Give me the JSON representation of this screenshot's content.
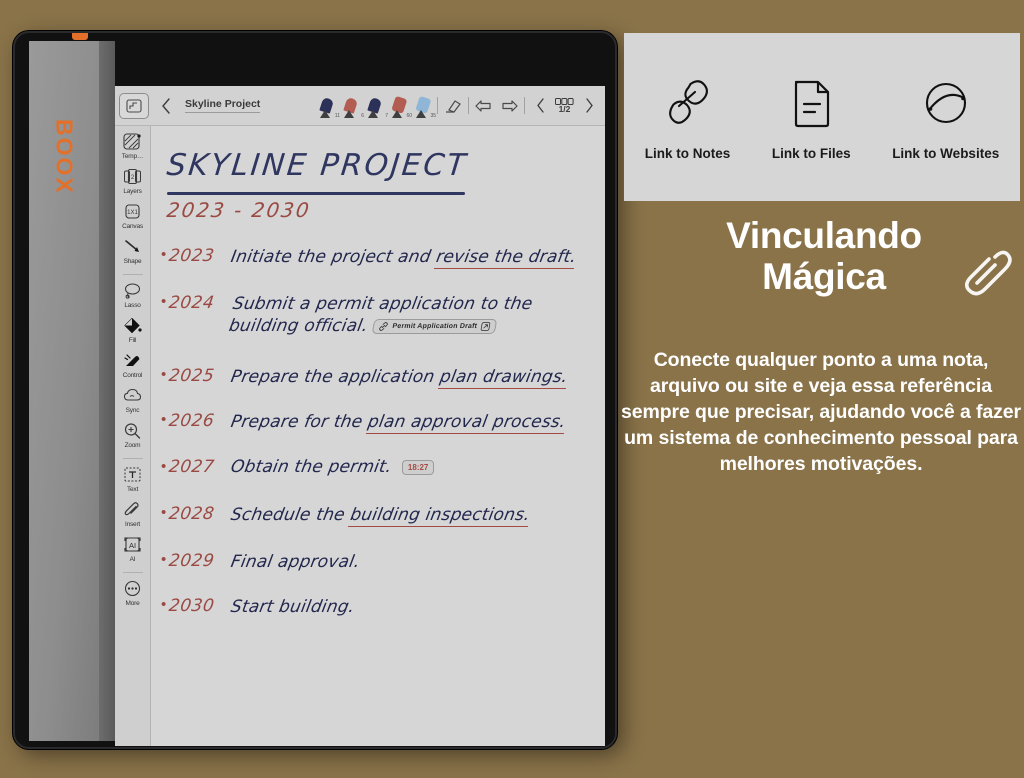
{
  "device": {
    "brand": "BOOX"
  },
  "app": {
    "topbar": {
      "template_icon": "template-icon",
      "back_icon": "chevron-left-icon",
      "note_title": "Skyline Project",
      "pens": [
        {
          "name": "pen-navy-fine",
          "size": "11",
          "color": "#2b3158",
          "type": "pen"
        },
        {
          "name": "pen-red-fine",
          "size": "6",
          "color": "#b35c52",
          "type": "pen"
        },
        {
          "name": "pen-navy-thin",
          "size": "7",
          "color": "#2b3158",
          "type": "pen"
        },
        {
          "name": "marker-red",
          "size": "60",
          "color": "#b35c52",
          "type": "marker"
        },
        {
          "name": "marker-blue",
          "size": "35",
          "color": "#8fb6d6",
          "type": "marker"
        }
      ],
      "eraser_icon": "eraser-icon",
      "undo_icon": "undo-arrow-icon",
      "redo_icon": "redo-arrow-icon",
      "prev_page_icon": "chevron-left-icon",
      "next_page_icon": "chevron-right-icon",
      "page_indicator": "1/2"
    },
    "rail": [
      {
        "label": "Temp…",
        "icon": "template-hatch-icon"
      },
      {
        "label": "Layers",
        "icon": "layers-icon"
      },
      {
        "label": "Canvas",
        "icon": "canvas-1x1-icon"
      },
      {
        "label": "Shape",
        "icon": "shape-line-icon"
      },
      {
        "label": "Lasso",
        "icon": "lasso-icon"
      },
      {
        "label": "Fill",
        "icon": "fill-bucket-icon"
      },
      {
        "label": "Control",
        "icon": "hand-control-icon"
      },
      {
        "label": "Sync",
        "icon": "cloud-sync-icon"
      },
      {
        "label": "Zoom",
        "icon": "zoom-magnifier-icon"
      },
      {
        "label": "Text",
        "icon": "text-box-icon"
      },
      {
        "label": "Insert",
        "icon": "paperclip-insert-icon"
      },
      {
        "label": "AI",
        "icon": "ai-icon"
      },
      {
        "label": "More",
        "icon": "more-dots-icon"
      }
    ],
    "note": {
      "title": "SKYLINE PROJECT",
      "subtitle": "2023 - 2030",
      "lines": [
        {
          "year": "2023",
          "before": "Initiate the project and ",
          "underlined": "revise the draft.",
          "after": ""
        },
        {
          "year": "2024",
          "before": "Submit a permit application to the building official.",
          "underlined": "",
          "after": "",
          "chip": {
            "type": "link",
            "label": "Permit Application Draft",
            "link_icon": "link-chain-icon",
            "open_icon": "external-link-icon"
          }
        },
        {
          "year": "2025",
          "before": "Prepare the application ",
          "underlined": "plan drawings.",
          "after": ""
        },
        {
          "year": "2026",
          "before": "Prepare for the ",
          "underlined": "plan approval process.",
          "after": ""
        },
        {
          "year": "2027",
          "before": "Obtain the permit.",
          "underlined": "",
          "after": "",
          "chip": {
            "type": "time",
            "label": "18:27"
          }
        },
        {
          "year": "2028",
          "before": "Schedule the ",
          "underlined": "building inspections.",
          "after": ""
        },
        {
          "year": "2029",
          "before": "Final approval.",
          "underlined": "",
          "after": ""
        },
        {
          "year": "2030",
          "before": "Start building.",
          "underlined": "",
          "after": ""
        }
      ]
    }
  },
  "link_panel": {
    "options": [
      {
        "label": "Link to Notes",
        "icon": "link-chain-icon"
      },
      {
        "label": "Link to Files",
        "icon": "file-document-icon"
      },
      {
        "label": "Link to Websites",
        "icon": "globe-icon"
      }
    ]
  },
  "promo": {
    "headline_line1": "Vinculando",
    "headline_line2": "Mágica",
    "headline_icon": "paperclip-icon",
    "body": "Conecte qualquer ponto a uma nota, arquivo ou site e veja essa referência sempre que precisar, ajudando você a fazer um sistema de conhecimento pessoal para melhores motivações."
  },
  "colors": {
    "background": "#8a7349",
    "panel": "#d6d6d6",
    "accent_orange": "#e2702a",
    "ink_navy": "#22274d",
    "ink_red": "#9a4a43"
  }
}
